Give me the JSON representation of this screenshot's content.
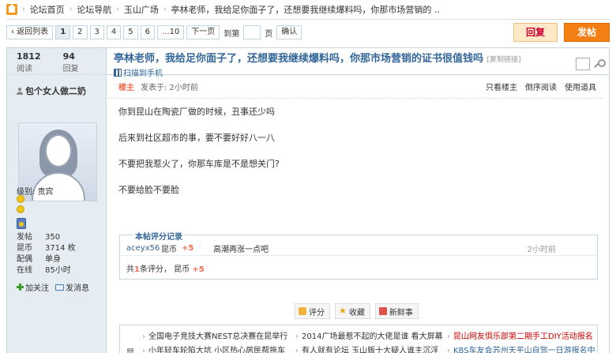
{
  "breadcrumb": {
    "items": [
      "论坛首页",
      "论坛导航",
      "玉山广场",
      "亭林老师，我给足你面子了，还想要我继续爆料吗，你那市场营销的 .."
    ]
  },
  "pager": {
    "back": "返回列表",
    "pages": [
      "1",
      "2",
      "3",
      "4",
      "5",
      "6",
      "...10"
    ],
    "next": "下一页",
    "goto": "到第",
    "page_unit": "页",
    "confirm": "确认"
  },
  "toolbar": {
    "reply": "回复",
    "post": "发帖"
  },
  "stats": {
    "views": "1812",
    "views_label": "阅读",
    "replies": "94",
    "replies_label": "回复"
  },
  "thread": {
    "title": "亭林老师，我给足你面子了，还想要我继续爆料吗，你那市场营销的证书很值钱吗",
    "copy_link": "[复制链接]",
    "scan": "扫描到手机"
  },
  "author": {
    "name": "包个女人做二奶",
    "level_label": "级别: 贵宾",
    "attrs": [
      {
        "k": "发帖",
        "v": "350"
      },
      {
        "k": "昆币",
        "v": "3714 枚"
      },
      {
        "k": "配偶",
        "v": "单身"
      },
      {
        "k": "在线",
        "v": "85小时"
      }
    ],
    "follow": "加关注",
    "message": "发消息"
  },
  "meta": {
    "owner": "楼主",
    "time": "发表于: 2小时前",
    "only_owner": "只看楼主",
    "reverse": "倒序阅读",
    "tools": "使用道具"
  },
  "post": {
    "lines": [
      "你到昆山在陶瓷厂做的时候，丑事还少吗",
      "后来到社区超市的事，要不要好好八一八",
      "不要把我惹火了，你那车库是不是想关门?",
      "不要给脸不要脸"
    ]
  },
  "rating": {
    "head": "本帖评分记录",
    "user": "aceyx56",
    "currency": "昆币",
    "points": "+5",
    "reason": "高潮再涨一点吧",
    "time": "2小时前",
    "total_prefix": "共",
    "total_count": "1",
    "total_mid": "条评分，",
    "total_currency": "昆币",
    "total_points": "+5"
  },
  "post_buttons": {
    "rate": "评分",
    "fav": "收藏",
    "fresh": "新鲜事"
  },
  "ads": {
    "col1": [
      "全国电子竞技大赛NEST总决赛在昆举行",
      "小年轻车轮陷大坑 小区热心居民帮拖车"
    ],
    "col2": [
      "2014广场最惹不起的大佬是谁 看大屏幕",
      "有人就有论坛 玉山贩十大疑人谁主沉浮"
    ],
    "col3": [
      "昆山网友俱乐部第二期手工DIY活动报名",
      "KBS车友会苏州天平山自驾一日游报名中"
    ],
    "bullet": "昆"
  }
}
